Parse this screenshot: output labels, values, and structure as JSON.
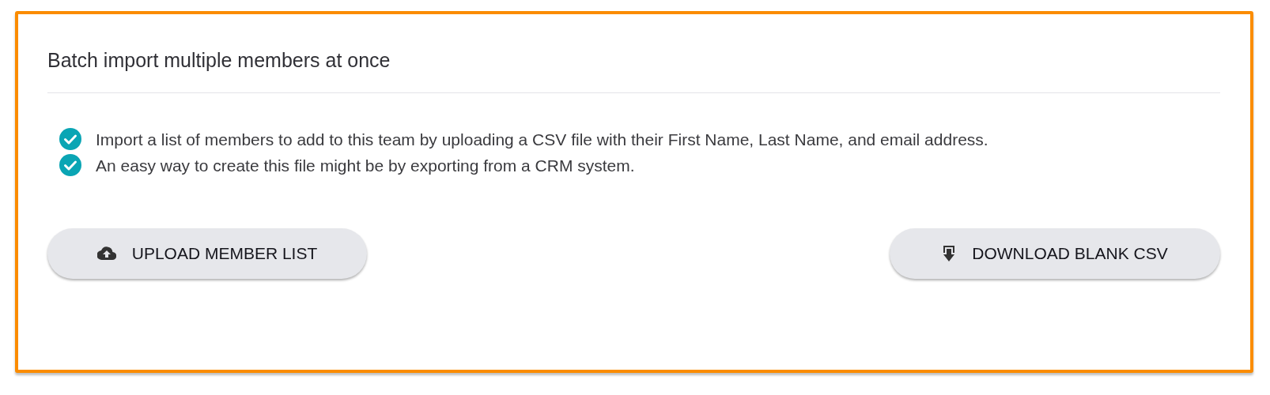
{
  "card": {
    "title": "Batch import multiple members at once",
    "points": [
      {
        "text": "Import a list of members to add to this team by uploading a CSV file with their First Name, Last Name, and email address.",
        "checked": true
      },
      {
        "text": "An easy way to create this file might be by exporting from a CRM system.",
        "checked": true
      }
    ],
    "buttons": [
      {
        "kind": "upload",
        "label": "UPLOAD MEMBER LIST"
      },
      {
        "kind": "download",
        "label": "DOWNLOAD BLANK CSV"
      }
    ]
  }
}
